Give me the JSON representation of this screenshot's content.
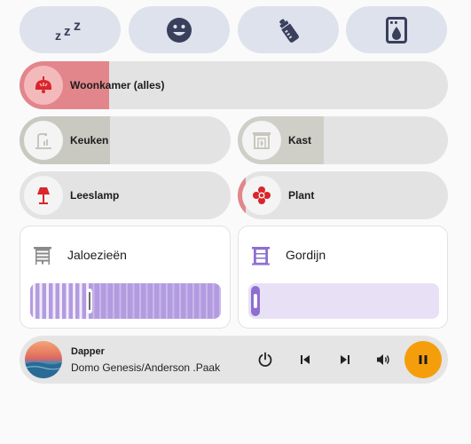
{
  "colors": {
    "pill_bg": "#dde2ec",
    "tile_bg": "#e3e3e3",
    "woonkamer_fill": "#e2868b",
    "keuken_fill": "#c9c9c1",
    "kast_fill": "#cfcfc8",
    "red_icon": "#d9252b",
    "cover_purple": "#a387d4",
    "cover_track": "#e8e1f5",
    "play_orange": "#f59e0b"
  },
  "scene_buttons": [
    {
      "icon": "sleep-icon"
    },
    {
      "icon": "smiley-icon"
    },
    {
      "icon": "baby-bottle-icon"
    },
    {
      "icon": "washing-machine-icon"
    }
  ],
  "lights": {
    "woonkamer": {
      "label": "Woonkamer (alles)",
      "icon": "ceiling-light-icon",
      "brightness": 0.21
    },
    "keuken": {
      "label": "Keuken",
      "icon": "kitchen-tap-icon",
      "brightness": 0.43
    },
    "kast": {
      "label": "Kast",
      "icon": "fireplace-icon",
      "brightness": 0.41
    },
    "leeslamp": {
      "label": "Leeslamp",
      "icon": "floor-lamp-icon",
      "brightness": 0
    },
    "plant": {
      "label": "Plant",
      "icon": "flower-icon",
      "brightness": 0.04
    }
  },
  "covers": {
    "jaloezieen": {
      "title": "Jaloezieën",
      "icon": "blinds-icon",
      "position": 0.31
    },
    "gordijn": {
      "title": "Gordijn",
      "icon": "curtains-icon",
      "position": 0.0
    }
  },
  "media": {
    "title": "Dapper",
    "artist": "Domo Genesis/Anderson .Paak",
    "state": "playing",
    "controls": [
      "power",
      "previous",
      "next",
      "volume",
      "pause"
    ]
  }
}
